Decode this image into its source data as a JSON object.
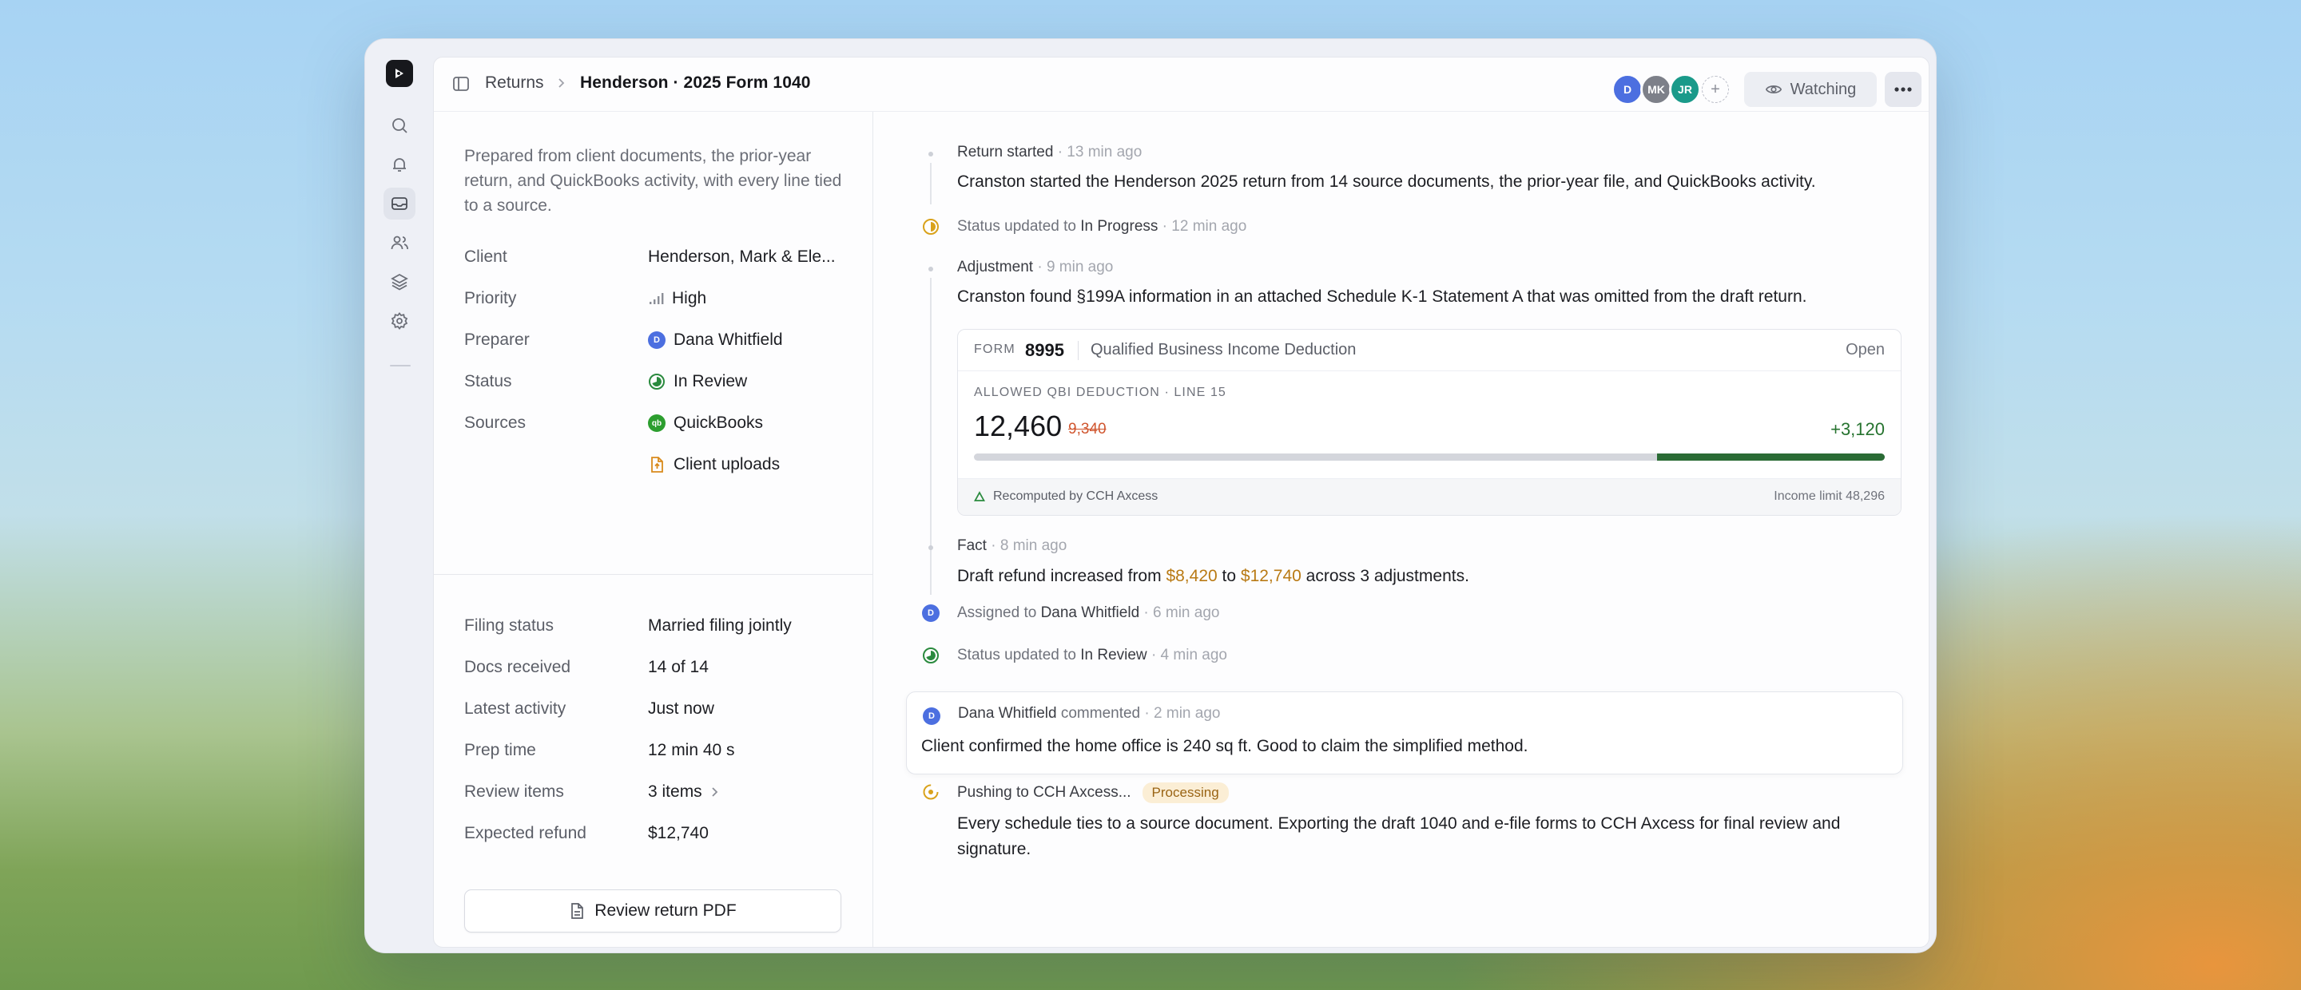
{
  "header": {
    "breadcrumb_root": "Returns",
    "title": "Henderson · 2025 Form 1040",
    "avatars": [
      {
        "initials": "D",
        "color": "#4c6fe0"
      },
      {
        "initials": "MK",
        "color": "#7d8089"
      },
      {
        "initials": "JR",
        "color": "#1a9a8a"
      }
    ],
    "watching_label": "Watching"
  },
  "details": {
    "description": "Prepared from client documents, the prior-year return, and QuickBooks activity, with every line tied to a source.",
    "client_label": "Client",
    "client_value": "Henderson, Mark & Ele...",
    "priority_label": "Priority",
    "priority_value": "High",
    "preparer_label": "Preparer",
    "preparer_initial": "D",
    "preparer_value": "Dana Whitfield",
    "status_label": "Status",
    "status_value": "In Review",
    "sources_label": "Sources",
    "source_1": "QuickBooks",
    "source_1_icon": "qb",
    "source_2": "Client uploads"
  },
  "stats": {
    "filing_status_label": "Filing status",
    "filing_status_value": "Married filing jointly",
    "docs_label": "Docs received",
    "docs_value": "14 of 14",
    "activity_label": "Latest activity",
    "activity_value": "Just now",
    "prep_label": "Prep time",
    "prep_value": "12 min 40 s",
    "review_label": "Review items",
    "review_value": "3 items",
    "refund_label": "Expected refund",
    "refund_value": "$12,740",
    "pdf_button": "Review return PDF"
  },
  "feed": {
    "e1_title": "Return started",
    "e1_time": "13 min ago",
    "e1_text": "Cranston started the Henderson 2025 return from 14 source documents, the prior-year file, and QuickBooks activity.",
    "e2_prefix": "Status updated to",
    "e2_status": "In Progress",
    "e2_time": "12 min ago",
    "e3_title": "Adjustment",
    "e3_time": "9 min ago",
    "e3_text": "Cranston found §199A information in an attached Schedule K-1 Statement A that was omitted from the draft return.",
    "card": {
      "form_label": "FORM",
      "form_number": "8995",
      "title": "Qualified Business Income Deduction",
      "open": "Open",
      "line_label": "ALLOWED QBI DEDUCTION · LINE 15",
      "value": "12,460",
      "old_value": "9,340",
      "delta": "+3,120",
      "bar_fraction": 0.25,
      "recomputed": "Recomputed by CCH Axcess",
      "income_limit": "Income limit 48,296"
    },
    "e4_title": "Fact",
    "e4_time": "8 min ago",
    "e4_text_a": "Draft refund increased from",
    "e4_from": "$8,420",
    "e4_to_word": "to",
    "e4_to": "$12,740",
    "e4_text_b": "across 3 adjustments.",
    "e5_prefix": "Assigned to",
    "e5_name": "Dana Whitfield",
    "e5_time": "6 min ago",
    "e6_prefix": "Status updated to",
    "e6_status": "In Review",
    "e6_time": "4 min ago",
    "comment_author": "Dana Whitfield",
    "comment_verb": "commented",
    "comment_time": "2 min ago",
    "comment_text": "Client confirmed the home office is 240 sq ft. Good to claim the simplified method.",
    "e8_title": "Pushing to CCH Axcess...",
    "e8_badge": "Processing",
    "e8_text": "Every schedule ties to a source document. Exporting the draft 1040 and e-file forms to CCH Axcess for final review and signature."
  },
  "colors": {
    "accent_blue": "#4c6fe0",
    "green": "#2a6b35",
    "gold": "#b97a14",
    "red": "#d0562f",
    "progress_yellow": "#d9a21b"
  }
}
